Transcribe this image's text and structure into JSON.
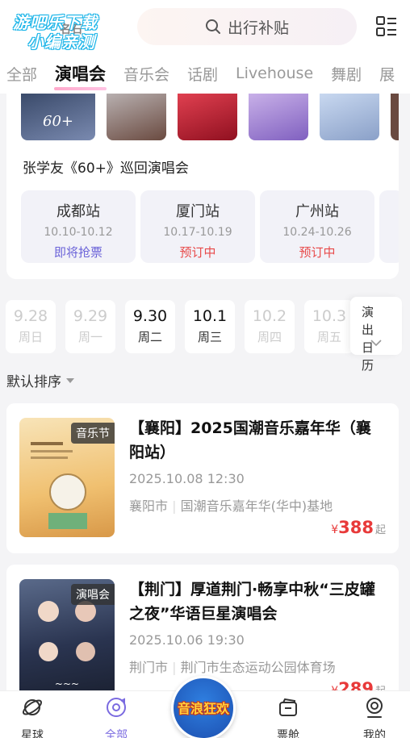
{
  "header": {
    "watermark_line1": "游吧乐下载",
    "watermark_line2": "小编亲测",
    "brand_partial": "名石",
    "search_placeholder": "出行补贴"
  },
  "tabs": [
    "全部",
    "演唱会",
    "音乐会",
    "话剧",
    "Livehouse",
    "舞剧",
    "展"
  ],
  "active_tab": "演唱会",
  "concert": {
    "title": "张学友《60+》巡回演唱会",
    "stations": [
      {
        "name": "成都站",
        "date": "10.10-10.12",
        "status": "即将抢票",
        "status_color": "#6a62d8"
      },
      {
        "name": "厦门站",
        "date": "10.17-10.19",
        "status": "预订中",
        "status_color": "#e84a4a"
      },
      {
        "name": "广州站",
        "date": "10.24-10.26",
        "status": "预订中",
        "status_color": "#e84a4a"
      }
    ]
  },
  "dates": [
    {
      "day": "9.28",
      "week": "周日",
      "enabled": false
    },
    {
      "day": "9.29",
      "week": "周一",
      "enabled": false
    },
    {
      "day": "9.30",
      "week": "周二",
      "enabled": true
    },
    {
      "day": "10.1",
      "week": "周三",
      "enabled": true
    },
    {
      "day": "10.2",
      "week": "周四",
      "enabled": false
    },
    {
      "day": "10.3",
      "week": "周五",
      "enabled": false
    }
  ],
  "calendar_label": "演出日历",
  "sort_label": "默认排序",
  "events": [
    {
      "badge": "音乐节",
      "title": "【襄阳】2025国潮音乐嘉年华（襄阳站）",
      "time": "2025.10.08 12:30",
      "city": "襄阳市",
      "venue": "国潮音乐嘉年华(华中)基地",
      "price_currency": "¥",
      "price": "388",
      "price_suffix": "起"
    },
    {
      "badge": "演唱会",
      "title": "【荆门】厚道荆门·畅享中秋“三皮罐之夜”华语巨星演唱会",
      "time": "2025.10.06 19:30",
      "city": "荆门市",
      "venue": "荆门市生态运动公园体育场",
      "price_currency": "¥",
      "price": "289",
      "price_suffix": "起"
    }
  ],
  "bottom_nav": [
    {
      "label": "星球",
      "icon": "planet-icon"
    },
    {
      "label": "全部",
      "icon": "all-icon",
      "active": true
    },
    {
      "label": "票舱",
      "icon": "ticket-icon"
    },
    {
      "label": "我的",
      "icon": "profile-icon"
    }
  ],
  "center_button_label": "音浪狂欢",
  "colors": {
    "accent": "#7a6ae0",
    "price": "#e83a3a"
  }
}
